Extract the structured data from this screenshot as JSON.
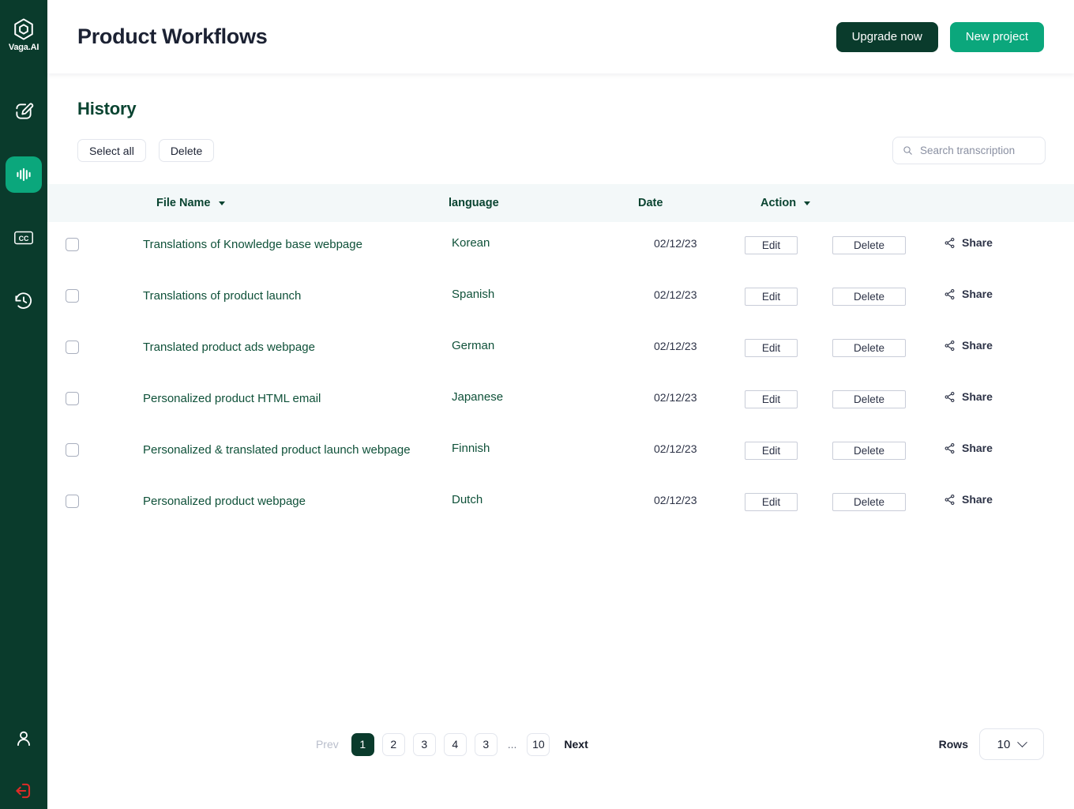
{
  "brand": {
    "name": "Vaga.AI",
    "logo_icon": "hexagon-logo-icon"
  },
  "sidebar": {
    "items": [
      {
        "icon": "edit-pencil-square-icon",
        "name": "edit",
        "active": false
      },
      {
        "icon": "audio-waveform-icon",
        "name": "transcribe",
        "active": true
      },
      {
        "icon": "closed-captions-icon",
        "name": "captions",
        "active": false
      },
      {
        "icon": "history-clock-icon",
        "name": "history",
        "active": false
      }
    ],
    "bottom_items": [
      {
        "icon": "user-profile-icon",
        "name": "profile"
      },
      {
        "icon": "logout-icon",
        "name": "logout"
      }
    ]
  },
  "header": {
    "title": "Product Workflows",
    "upgrade_label": "Upgrade now",
    "new_project_label": "New project"
  },
  "history": {
    "section_title": "History",
    "select_all_label": "Select all",
    "delete_label": "Delete",
    "search_placeholder": "Search transcription",
    "search_value": "",
    "search_icon": "search-icon"
  },
  "table": {
    "columns": [
      {
        "label": "File Name",
        "sortable": true
      },
      {
        "label": "language",
        "sortable": false
      },
      {
        "label": "Date",
        "sortable": false
      },
      {
        "label": "Action",
        "sortable": true
      }
    ],
    "row_actions": {
      "edit_label": "Edit",
      "delete_label": "Delete",
      "share_label": "Share",
      "share_icon": "share-icon"
    },
    "rows": [
      {
        "name": "Translations of Knowledge base webpage",
        "language": "Korean",
        "date": "02/12/23",
        "checked": false
      },
      {
        "name": "Translations of product launch",
        "language": "Spanish",
        "date": "02/12/23",
        "checked": false
      },
      {
        "name": "Translated product ads webpage",
        "language": "German",
        "date": "02/12/23",
        "checked": false
      },
      {
        "name": "Personalized product HTML email",
        "language": "Japanese",
        "date": "02/12/23",
        "checked": false
      },
      {
        "name": "Personalized & translated product launch webpage",
        "language": "Finnish",
        "date": "02/12/23",
        "checked": false
      },
      {
        "name": "Personalized product webpage",
        "language": "Dutch",
        "date": "02/12/23",
        "checked": false
      }
    ]
  },
  "pagination": {
    "prev_label": "Prev",
    "next_label": "Next",
    "pages": [
      "1",
      "2",
      "3",
      "4",
      "3",
      "...",
      "10"
    ],
    "active_page": "1",
    "rows_label": "Rows",
    "rows_value": "10",
    "chevron_icon": "chevron-down-icon"
  },
  "colors": {
    "sidebar_bg": "#0A3B2C",
    "accent_green": "#0BA77C",
    "dark_green": "#0A4431",
    "row_text": "#0F5139",
    "table_header_bg": "#F3F8F9",
    "logout_red": "#E02B27"
  }
}
